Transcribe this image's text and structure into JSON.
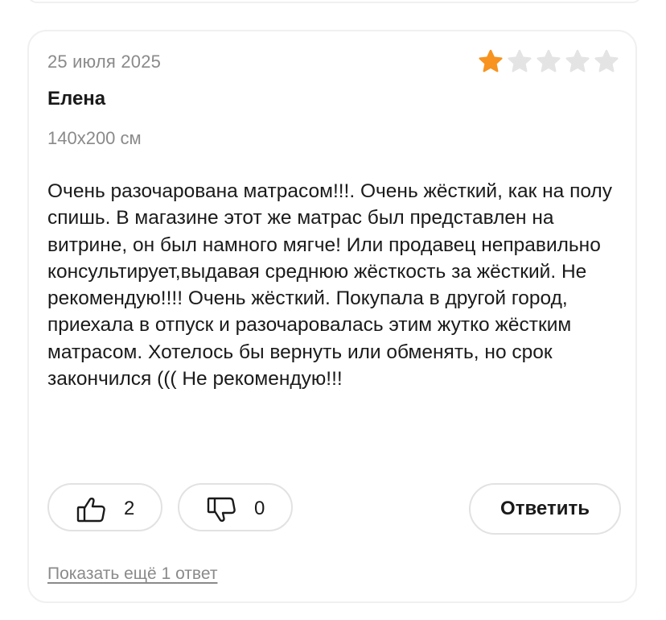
{
  "review": {
    "date": "25 июля 2025",
    "rating": 1,
    "rating_max": 5,
    "author": "Елена",
    "size": "140x200 см",
    "text": "Очень разочарована матрасом!!!. Очень жёсткий, как на полу спишь. В магазине этот же матрас был представлен на витрине, он был намного мягче! Или продавец неправильно консультирует,выдавая среднюю жёсткость за жёсткий. Не рекомендую!!!! Очень жёсткий. Покупала в другой город, приехала в отпуск и разочаровалась этим жутко жёстким матрасом. Хотелось бы вернуть или обменять, но срок закончился ((( Не рекомендую!!!"
  },
  "actions": {
    "likes": "2",
    "dislikes": "0",
    "reply_label": "Ответить",
    "more_answers_label": "Показать ещё 1 ответ"
  },
  "icons": {
    "star_filled": "star-filled-icon",
    "star_empty": "star-empty-icon",
    "like": "thumbs-up-icon",
    "dislike": "thumbs-down-icon"
  },
  "colors": {
    "star_filled": "#f7931e",
    "star_empty": "#e4e4e4",
    "muted_text": "#8a8a8a",
    "border": "#e2e2e2"
  }
}
